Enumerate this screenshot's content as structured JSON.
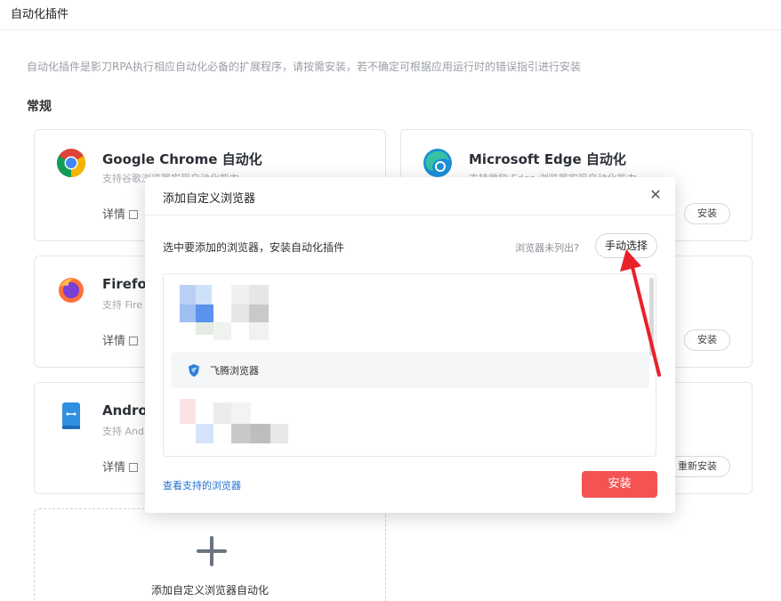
{
  "page": {
    "title": "自动化插件",
    "description": "自动化插件是影刀RPA执行相应自动化必备的扩展程序，请按需安装，若不确定可根据应用运行时的错误指引进行安装",
    "section": "常规"
  },
  "cards": [
    {
      "name": "Google Chrome 自动化",
      "subtitle": "支持谷歌浏览器实现自动化能力",
      "detail": "详情",
      "action": ""
    },
    {
      "name": "Microsoft Edge 自动化",
      "subtitle": "支持微软 Edge 浏览器实现自动化能力",
      "detail": "",
      "action": "安装"
    },
    {
      "name": "Firefox",
      "subtitle": "支持 Fire",
      "detail": "详情",
      "action": ""
    },
    {
      "name": "",
      "subtitle": "",
      "detail": "",
      "action": "安装"
    },
    {
      "name": "Andro",
      "subtitle": "支持 And",
      "detail": "详情",
      "action": ""
    },
    {
      "name": "",
      "subtitle": "",
      "detail": "",
      "action": "重新安装"
    }
  ],
  "add_card": {
    "label": "添加自定义浏览器自动化"
  },
  "modal": {
    "title": "添加自定义浏览器",
    "close_icon": "close-icon",
    "hint": "选中要添加的浏览器，安装自动化插件",
    "not_listed": "浏览器未列出?",
    "manual_select": "手动选择",
    "browser_item": "飞腾浏览器",
    "supported_link": "查看支持的浏览器",
    "install": "安装"
  },
  "colors": {
    "accent_red": "#f45353",
    "link_blue": "#1f6fd1",
    "annotation_arrow": "#e8212a"
  }
}
